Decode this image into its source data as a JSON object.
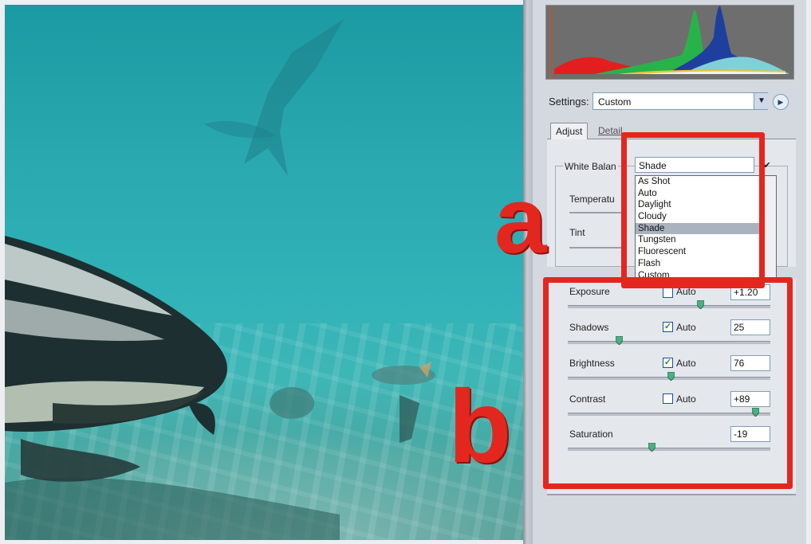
{
  "settings": {
    "label": "Settings:",
    "value": "Custom"
  },
  "tabs": [
    "Adjust",
    "Detail"
  ],
  "white_balance": {
    "group_label": "White Balan",
    "selected": "Shade",
    "options": [
      "As Shot",
      "Auto",
      "Daylight",
      "Cloudy",
      "Shade",
      "Tungsten",
      "Fluorescent",
      "Flash",
      "Custom"
    ],
    "labels": {
      "temperature": "Temperatu",
      "tint": "Tint"
    }
  },
  "annotations": {
    "a": "a",
    "b": "b"
  },
  "tone_controls": [
    {
      "label": "Exposure",
      "auto": false,
      "auto_label": "Auto",
      "value": "+1.20",
      "slider": 0.65
    },
    {
      "label": "Shadows",
      "auto": true,
      "auto_label": "Auto",
      "value": "25",
      "slider": 0.25
    },
    {
      "label": "Brightness",
      "auto": true,
      "auto_label": "Auto",
      "value": "76",
      "slider": 0.5
    },
    {
      "label": "Contrast",
      "auto": false,
      "auto_label": "Auto",
      "value": "+89",
      "slider": 0.93
    },
    {
      "label": "Saturation",
      "auto": null,
      "auto_label": "",
      "value": "-19",
      "slider": 0.4
    }
  ],
  "colors": {
    "highlight": "#e3271f",
    "panel": "#d4d8df"
  },
  "icons": {
    "dropdown": "chevron-down-icon",
    "menu": "circle-arrow-icon",
    "check": "checkmark-icon"
  }
}
